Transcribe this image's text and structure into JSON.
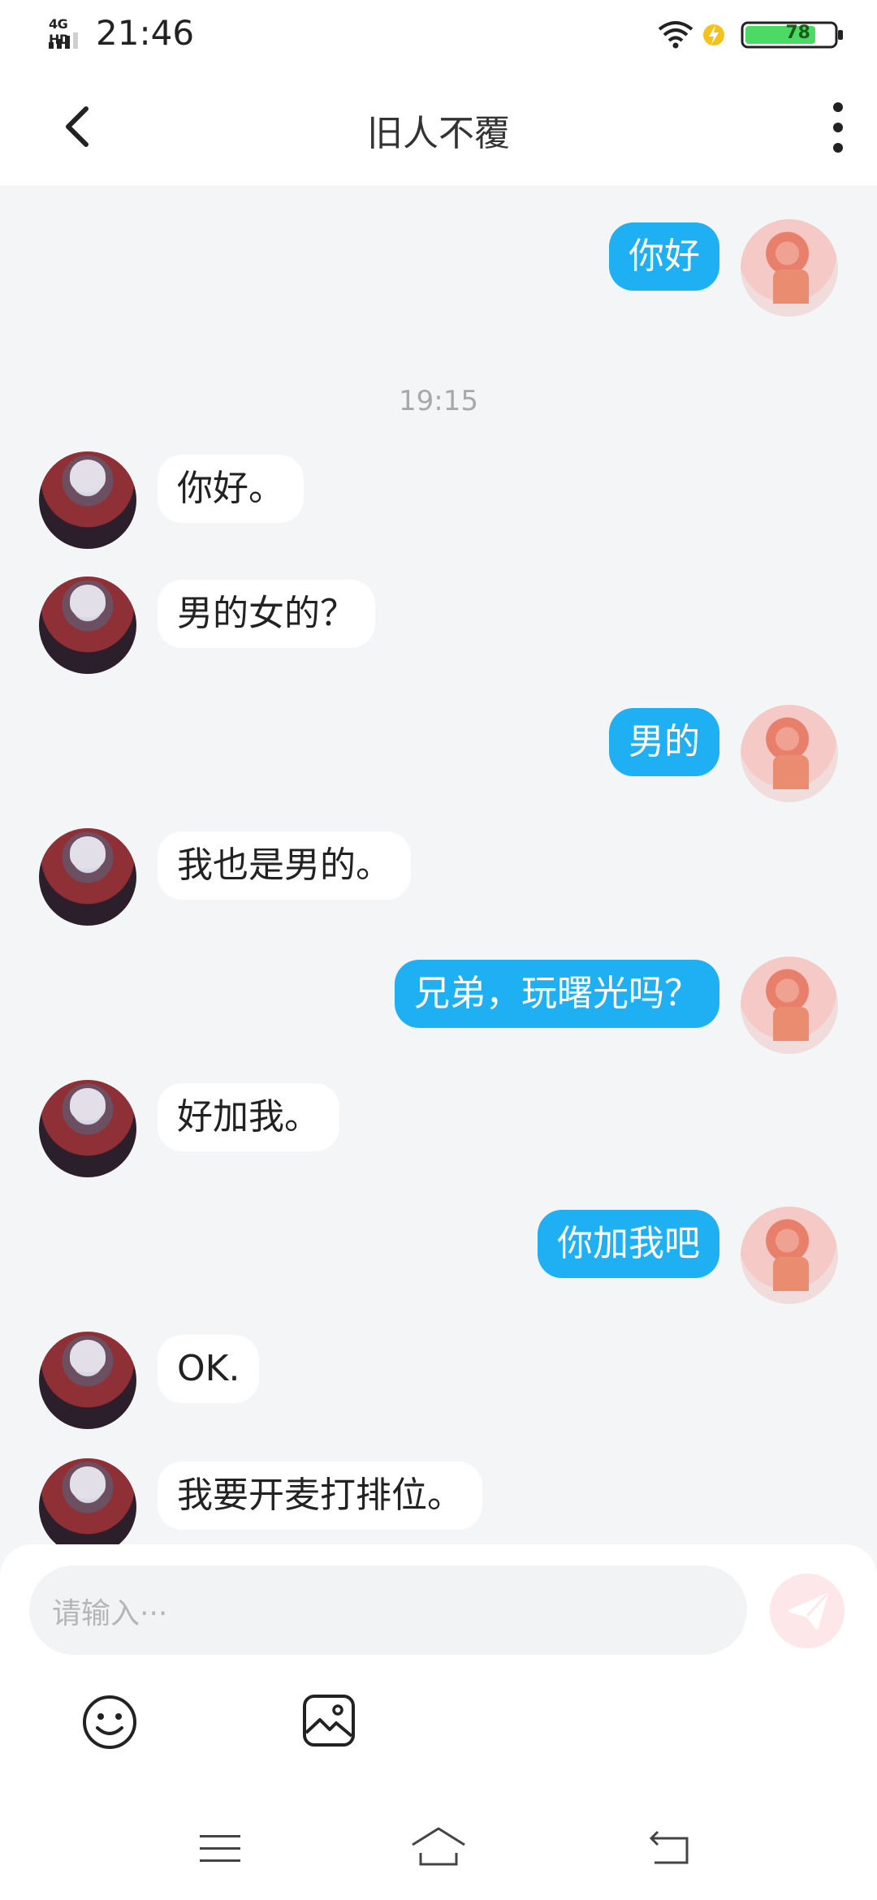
{
  "status_bar": {
    "network": "4G HD",
    "time": "21:46",
    "battery": "78"
  },
  "header": {
    "title": "旧人不覆"
  },
  "messages": [
    {
      "side": "out",
      "text": "你好"
    },
    {
      "side": "time",
      "text": "19:15"
    },
    {
      "side": "in",
      "text": "你好。"
    },
    {
      "side": "in",
      "text": "男的女的？"
    },
    {
      "side": "out",
      "text": "男的"
    },
    {
      "side": "in",
      "text": "我也是男的。"
    },
    {
      "side": "out",
      "text": "兄弟，玩曙光吗？"
    },
    {
      "side": "in",
      "text": "好加我。"
    },
    {
      "side": "out",
      "text": "你加我吧"
    },
    {
      "side": "in",
      "text": "OK."
    },
    {
      "side": "in",
      "text": "我要开麦打排位。"
    }
  ],
  "composer": {
    "placeholder": "请输入···"
  },
  "icons": {
    "back": "back-arrow-icon",
    "more": "more-vertical-icon",
    "send": "send-icon",
    "emoji": "emoji-icon",
    "image": "image-icon",
    "nav_menu": "menu-icon",
    "nav_home": "home-icon",
    "nav_back": "back-icon"
  },
  "colors": {
    "accent": "#1eb0f2",
    "background": "#f4f5f7",
    "send_disabled": "#fde7e8"
  }
}
